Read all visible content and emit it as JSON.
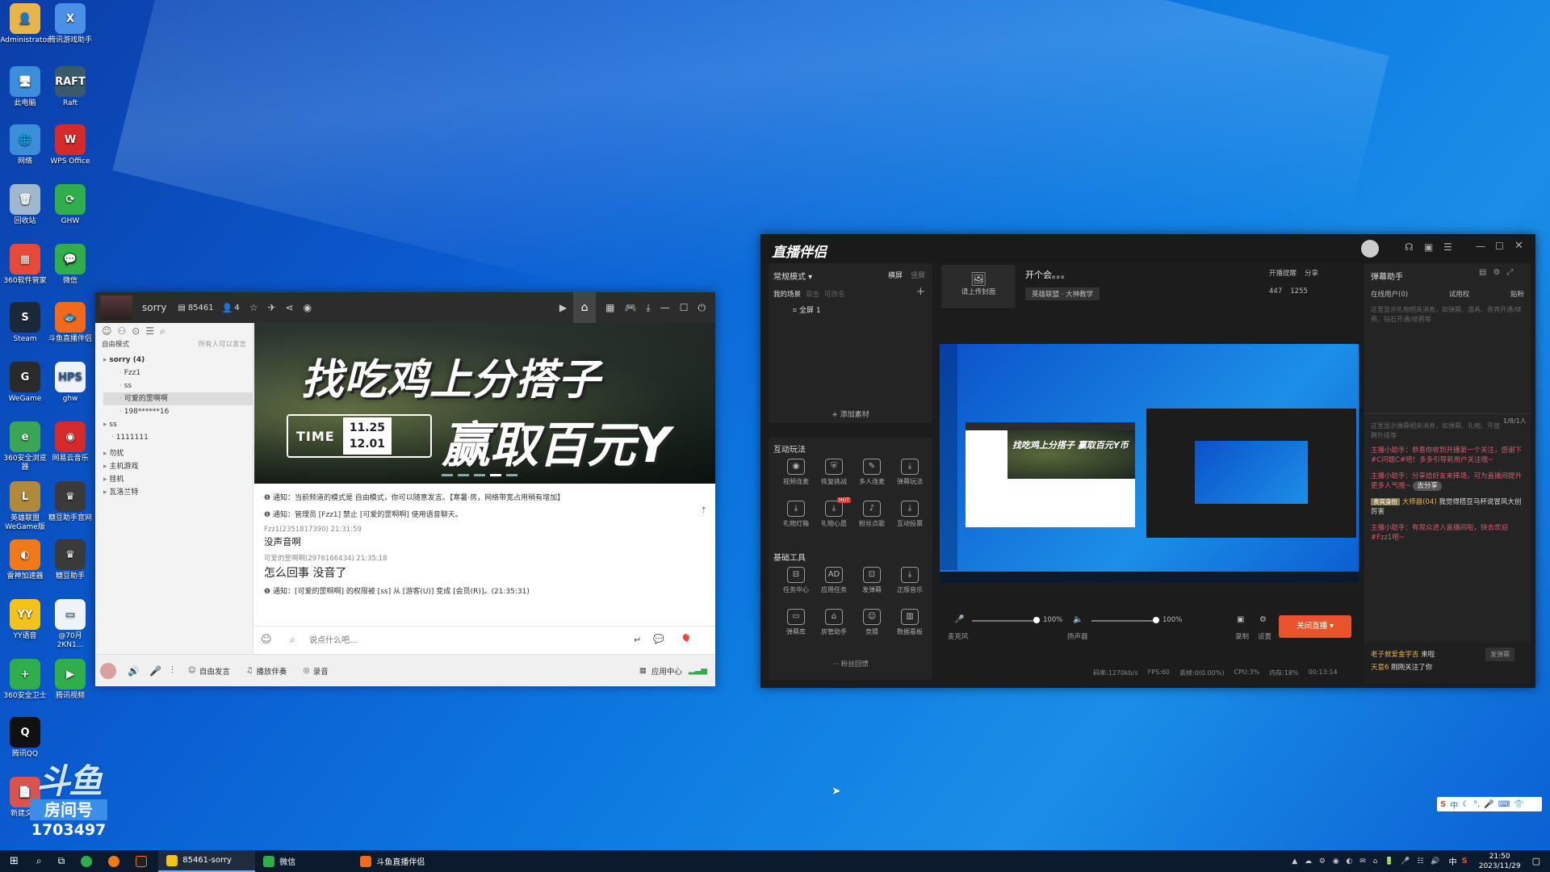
{
  "desktop": {
    "icons": [
      {
        "label": "Administrator",
        "glyph": "👤",
        "color": "#e7b54a"
      },
      {
        "label": "此电脑",
        "glyph": "🖥",
        "color": "#3b8fd8"
      },
      {
        "label": "网络",
        "glyph": "🌐",
        "color": "#3b8fd8"
      },
      {
        "label": "回收站",
        "glyph": "🗑",
        "color": "#9fb8d0"
      },
      {
        "label": "360软件管家",
        "glyph": "▦",
        "color": "#e84a3a"
      },
      {
        "label": "Steam",
        "glyph": "S",
        "color": "#1b2838"
      },
      {
        "label": "WeGame",
        "glyph": "G",
        "color": "#2a2a2a"
      },
      {
        "label": "360安全浏览器",
        "glyph": "e",
        "color": "#3aa655"
      },
      {
        "label": "英雄联盟WeGame版",
        "glyph": "L",
        "color": "#b08a3a"
      },
      {
        "label": "雷神加速器",
        "glyph": "◐",
        "color": "#f07a1a"
      },
      {
        "label": "YY语音",
        "glyph": "YY",
        "color": "#f3c31a"
      },
      {
        "label": "360安全卫士",
        "glyph": "+",
        "color": "#2fae4b"
      },
      {
        "label": "腾讯QQ",
        "glyph": "Q",
        "color": "#111"
      },
      {
        "label": "新建文件",
        "glyph": "📄",
        "color": "#d9534f"
      },
      {
        "label": "腾讯游戏助手",
        "glyph": "X",
        "color": "#4a8fe8"
      },
      {
        "label": "Raft",
        "glyph": "RAFT",
        "color": "#3a5a6a"
      },
      {
        "label": "WPS Office",
        "glyph": "W",
        "color": "#d42a2a"
      },
      {
        "label": "GHW",
        "glyph": "⟳",
        "color": "#2fae4b"
      },
      {
        "label": "微信",
        "glyph": "💬",
        "color": "#2fae4b"
      },
      {
        "label": "斗鱼直播伴侣",
        "glyph": "🐟",
        "color": "#f06a1a"
      },
      {
        "label": "ghw",
        "glyph": "HPS",
        "color": "#eef3f8"
      },
      {
        "label": "网易云音乐",
        "glyph": "◉",
        "color": "#d42a2a"
      },
      {
        "label": "糖豆助手官网",
        "glyph": "♛",
        "color": "#3a3a3a"
      },
      {
        "label": "糖豆助手",
        "glyph": "♛",
        "color": "#3a3a3a"
      },
      {
        "label": "@70月2KN1...",
        "glyph": "▭",
        "color": "#eef3f8"
      },
      {
        "label": "腾讯视频",
        "glyph": "▶",
        "color": "#2fae4b"
      }
    ],
    "logo_text": "斗鱼",
    "room_label": "房间号",
    "room_number": "1703497"
  },
  "chat": {
    "title": "sorry",
    "room_id": "85461",
    "members": "4",
    "mode_label": "自由模式",
    "mode_right": "所有人可以发言",
    "tree": [
      {
        "text": "sorry (4)",
        "indent": 0
      },
      {
        "text": "Fzz1",
        "indent": 2
      },
      {
        "text": "ss",
        "indent": 2
      },
      {
        "text": "可爱的罡啊啊",
        "indent": 2
      },
      {
        "text": "198******16",
        "indent": 2
      },
      {
        "text": "ss",
        "indent": 0
      },
      {
        "text": "1111111",
        "indent": 1
      },
      {
        "text": "勿扰",
        "indent": 0
      },
      {
        "text": "主机游戏",
        "indent": 0
      },
      {
        "text": "挂机",
        "indent": 0
      },
      {
        "text": "瓦洛兰特",
        "indent": 0
      }
    ],
    "banner": {
      "line1": "找吃鸡上分搭子",
      "time_label": "TIME",
      "date1": "11.25",
      "date2": "12.01",
      "line2": "赢取百元Y币"
    },
    "messages": [
      {
        "kind": "notice",
        "text": "通知：当前频道的模式是 自由模式，你可以随意发言。【寒暑·房，网络带宽占用稍有增加】"
      },
      {
        "kind": "notice",
        "text": "通知：管理员 [Fzz1] 禁止 [可爱的罡啊啊] 使用语音聊天。"
      },
      {
        "kind": "head",
        "text": "Fzz1(2351817390) 21:31:59"
      },
      {
        "kind": "body",
        "text": "没声音啊"
      },
      {
        "kind": "head",
        "text": "可爱的罡啊啊(2976166434) 21:35:18"
      },
      {
        "kind": "body_large",
        "text": "怎么回事 没音了"
      },
      {
        "kind": "notice",
        "text": "通知：[可爱的罡啊啊] 的权限被 [ss] 从 [游客(U)] 变成 [会员(R)]。(21:35:31)"
      }
    ],
    "input_placeholder": "说点什么吧...",
    "bottom": {
      "free_talk": "自由发言",
      "music": "播放伴奏",
      "record": "录音",
      "app_center": "应用中心"
    }
  },
  "stream": {
    "app_name": "直播伴侣",
    "mode": "常规模式",
    "landscape": "横屏",
    "portrait": "竖屏",
    "scene_tabs": [
      "我的场景",
      "双击",
      "可改名"
    ],
    "scene_item": "全屏 1",
    "add_material": "+ 添加素材",
    "interact_title": "互动玩法",
    "interact_tools": [
      "视频连麦",
      "恢复挑战",
      "多人连麦",
      "弹幕玩法",
      "礼物灯箱",
      "礼物心愿",
      "粉丝点歌",
      "互动投票"
    ],
    "hot_badge": "HOT",
    "basic_title": "基础工具",
    "basic_tools": [
      "任务中心",
      "应用任务",
      "发弹幕",
      "正版音乐",
      "弹幕库",
      "房管助手",
      "竞猜",
      "数据看板"
    ],
    "fans_more": "粉丝回馈",
    "upload_cover": "请上传封面",
    "stream_title": "开个会。。。",
    "category": "英雄联盟 · 大神教学",
    "top_links": [
      "开播提醒",
      "分享"
    ],
    "fans_count": "447",
    "likes_count": "1255",
    "mic_label": "麦克风",
    "mic_vol": "100%",
    "speaker_label": "扬声器",
    "spk_vol": "100%",
    "record_label": "录制",
    "settings_label": "设置",
    "close_live": "关闭直播",
    "status": [
      "码率:1270kb/s",
      "FPS:60",
      "丢帧:0(0.00%)",
      "CPU:3%",
      "内存:18%",
      "00:13:14"
    ],
    "preview_banner": "找吃鸡上分搭子 赢取百元Y币",
    "danmu_title": "弹幕助手",
    "danmu_tabs": [
      "在线用户(0)",
      "试用权",
      "贴粉"
    ],
    "danmu_hint": "这里显示礼物相关消息，如弹幕、道具、贵宾开通/续费，钻石开通/续费等",
    "danmu_hint2": "这里显示弹幕相关消息，如弹幕、礼物、开放聘升级等",
    "online": "1/8/1人",
    "danmu": [
      "主播小助手：恭喜你收到开播第一个关注，感谢下#C问题C#吧！多多引导新用户关注哦~",
      "主播小助手：分享给好友来捧场，可为直播间提升更多人气哦~",
      "主播小助手：有观众进入直播间啦，快去欢迎#Fzz1吧~"
    ],
    "share_btn": "去分享",
    "highlight_tag": "贵宾身份",
    "highlight_user": "大师器(04)",
    "highlight_text": "我觉得搭豆马杯说冒风大创厉害",
    "bottom_msgs": [
      {
        "user": "老子就爱金字吉",
        "text": "来啦"
      },
      {
        "user": "天意6",
        "text": "刚刚关注了你"
      }
    ],
    "send_btn": "发弹幕"
  },
  "taskbar": {
    "items": [
      {
        "label": "85461-sorry",
        "color": "#f3c31a"
      },
      {
        "label": "微信",
        "color": "#2fae4b"
      },
      {
        "label": "斗鱼直播伴侣",
        "color": "#f06a1a"
      }
    ],
    "time": "21:50",
    "date": "2023/11/29",
    "ime": "中"
  }
}
